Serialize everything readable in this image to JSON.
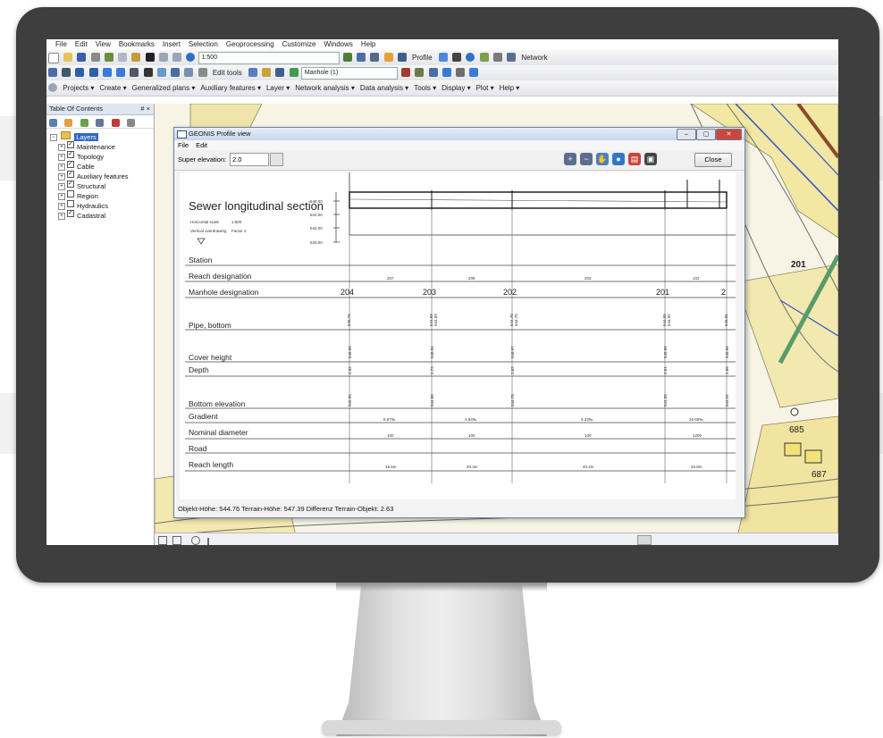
{
  "menubar": [
    "File",
    "Edit",
    "View",
    "Bookmarks",
    "Insert",
    "Selection",
    "Geoprocessing",
    "Customize",
    "Windows",
    "Help"
  ],
  "toolbar1": {
    "scale": "1:500",
    "profile_label": "Profile",
    "network_label": "Network"
  },
  "toolbar2": {
    "edit_tools_label": "Edit tools",
    "manhole_box": "Manhole (1)"
  },
  "toolbar3": {
    "items": [
      "Projects",
      "Create",
      "Generalized plans",
      "Auxiliary features",
      "Layer",
      "Network analysis",
      "Data analysis",
      "Tools",
      "Display",
      "Plot",
      "Help"
    ]
  },
  "toc": {
    "title": "Table Of Contents",
    "pin": "# ×",
    "root": "Layers",
    "layers": [
      {
        "label": "Maintenance",
        "checked": true
      },
      {
        "label": "Topology",
        "checked": true
      },
      {
        "label": "Cable",
        "checked": true
      },
      {
        "label": "Auxiliary features",
        "checked": true
      },
      {
        "label": "Structural",
        "checked": true
      },
      {
        "label": "Region",
        "checked": false
      },
      {
        "label": "Hydraulics",
        "checked": false
      },
      {
        "label": "Cadastral",
        "checked": true
      }
    ]
  },
  "map": {
    "labels": [
      "201",
      "685",
      "687"
    ],
    "bg_color": "#f7f4e6"
  },
  "profile_window": {
    "title": "GEONIS Profile view",
    "menu": [
      "File",
      "Edit"
    ],
    "super_elevation_label": "Super elevation:",
    "super_elevation_value": "2.0",
    "close_label": "Close",
    "status": "Objekt-Höhe: 544.76   Terrain-Höhe: 547.39   Differenz Terrain-Objekt: 2.63",
    "section_title": "Sewer longitudinal section",
    "horizontal_scale_label": "Horizontal scale",
    "horizontal_scale_value": "1:500",
    "vertical_label": "Vertical overdrawing",
    "vertical_value": "Factor 2",
    "elevation_ticks": [
      "548.00",
      "544.00",
      "542.00",
      "540.00"
    ],
    "rows": [
      "Station",
      "Reach designation",
      "Manhole designation",
      "Pipe, bottom",
      "Cover height",
      "Depth",
      "Bottom elevation",
      "Gradient",
      "Nominal diameter",
      "Road",
      "Reach length"
    ],
    "manholes": [
      "204",
      "203",
      "202",
      "201",
      "2"
    ],
    "reaches": [
      "207",
      "208",
      "203",
      "102"
    ],
    "pipe_bottom": [
      [
        "545.76"
      ],
      [
        "544.68",
        "544.68"
      ],
      [
        "544.75",
        "544.75"
      ],
      [
        "544.99",
        "544.92"
      ],
      [
        "545.05"
      ]
    ],
    "cover_heights": [
      "548.96",
      "548.94",
      "548.97",
      "548.96",
      "548.96"
    ],
    "depths": [
      "2.02",
      "2.73",
      "2.62",
      "2.61",
      "2.66"
    ],
    "bottom_elevations": [
      "545.95",
      "544.88",
      "544.70",
      "544.35",
      "543.52"
    ],
    "gradients": [
      "6.67‰",
      "4.84‰",
      "6.33‰",
      "26.65‰"
    ],
    "diameters": [
      "100",
      "100",
      "100",
      "1200"
    ],
    "reach_lengths": [
      "15.5m",
      "20.3m",
      "40.2m",
      "10.8m"
    ]
  }
}
